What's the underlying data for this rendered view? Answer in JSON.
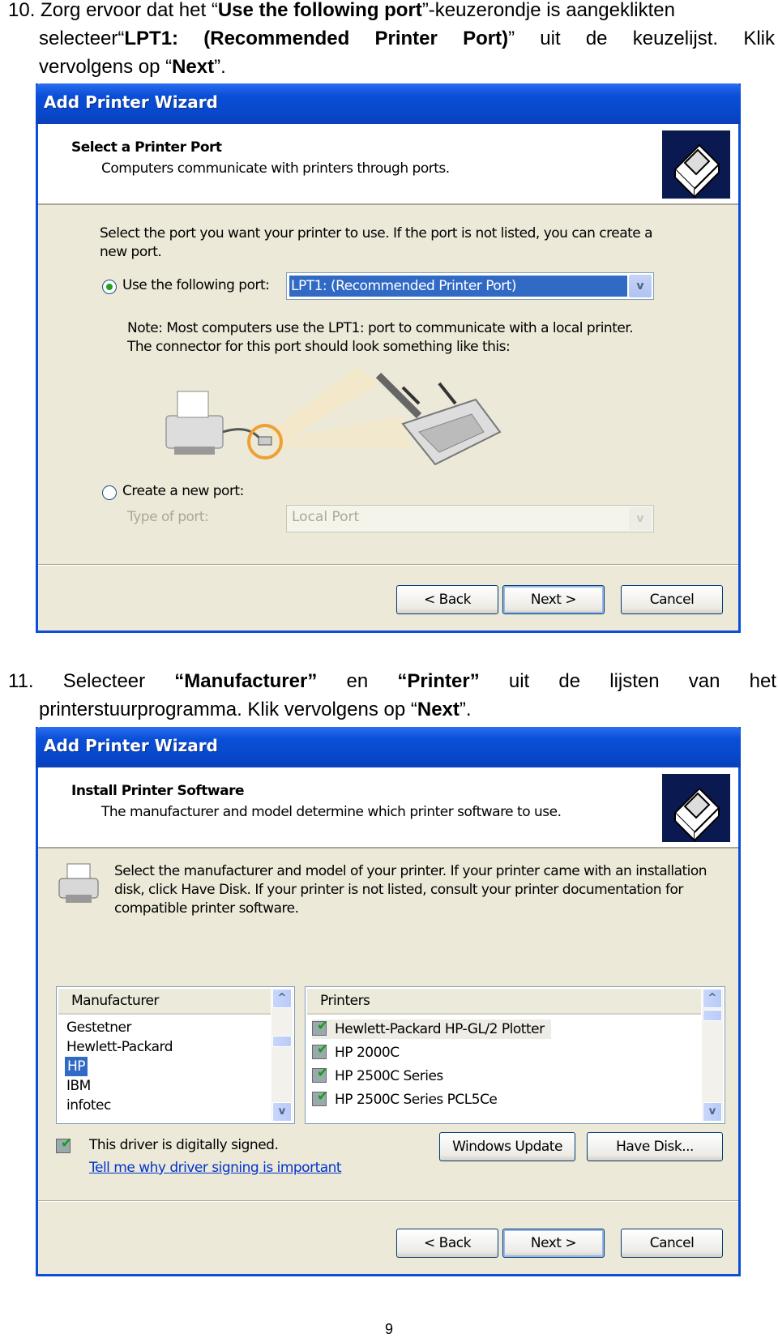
{
  "step10": {
    "number": "10.",
    "line1_pre": "Zorg ervoor dat het “",
    "line1_bold": "Use the following port",
    "line1_post": "”-keuzerondje is aangeklikten",
    "line2_pre": "selecteer“",
    "line2_bold": "LPT1: (Recommended Printer Port)",
    "line2_post": "” uit de keuzelijst. Klik",
    "line3_pre": "vervolgens op “",
    "line3_bold": "Next",
    "line3_post": "”."
  },
  "wizard1": {
    "title": "Add Printer Wizard",
    "header_title": "Select a Printer Port",
    "header_subtitle": "Computers communicate with printers through ports.",
    "instruction_line1": "Select the port you want your printer to use.  If the port is not listed, you can create a",
    "instruction_line2": "new port.",
    "use_port_label": "Use the following port:",
    "use_port_selected": true,
    "port_value": "LPT1: (Recommended Printer Port)",
    "note_line1": "Note: Most computers use the LPT1: port to communicate with a local printer.",
    "note_line2": "The connector for this port should look something like this:",
    "create_port_label": "Create a new port:",
    "type_of_port_label": "Type of port:",
    "type_of_port_value": "Local Port",
    "back": "< Back",
    "next": "Next >",
    "cancel": "Cancel"
  },
  "step11": {
    "number": "11.",
    "line1_a": "Selecteer",
    "line1_b": "“Manufacturer”",
    "line1_c": "en",
    "line1_d": "“Printer”",
    "line1_e": "uit",
    "line1_f": "de",
    "line1_g": "lijsten",
    "line1_h": "van",
    "line1_i": "het",
    "line2_pre": "printerstuurprogramma. Klik vervolgens op “",
    "line2_bold": "Next",
    "line2_post": "”."
  },
  "wizard2": {
    "title": "Add Printer Wizard",
    "header_title": "Install Printer Software",
    "header_subtitle": "The manufacturer and model determine which printer software to use.",
    "instruction_line1": "Select the manufacturer and model of your printer. If your printer came with an installation",
    "instruction_line2": "disk, click Have Disk. If your printer is not listed, consult your printer documentation for",
    "instruction_line3": "compatible printer software.",
    "manufacturer_header": "Manufacturer",
    "manufacturers": [
      "Gestetner",
      "Hewlett-Packard",
      "HP",
      "IBM",
      "infotec"
    ],
    "selected_manufacturer": "HP",
    "printers_header": "Printers",
    "printers": [
      "Hewlett-Packard HP-GL/2 Plotter",
      "HP 2000C",
      "HP 2500C Series",
      "HP 2500C Series PCL5Ce"
    ],
    "signed_text": "This driver is digitally signed.",
    "signing_link": "Tell me why driver signing is important",
    "windows_update": "Windows Update",
    "have_disk": "Have Disk...",
    "back": "< Back",
    "next": "Next >",
    "cancel": "Cancel"
  },
  "page_number": "9",
  "colors": {
    "titlebar": "#0A4FD8",
    "dialog_bg": "#ECE9D8",
    "selection": "#316AC5",
    "link": "#0033CC"
  }
}
